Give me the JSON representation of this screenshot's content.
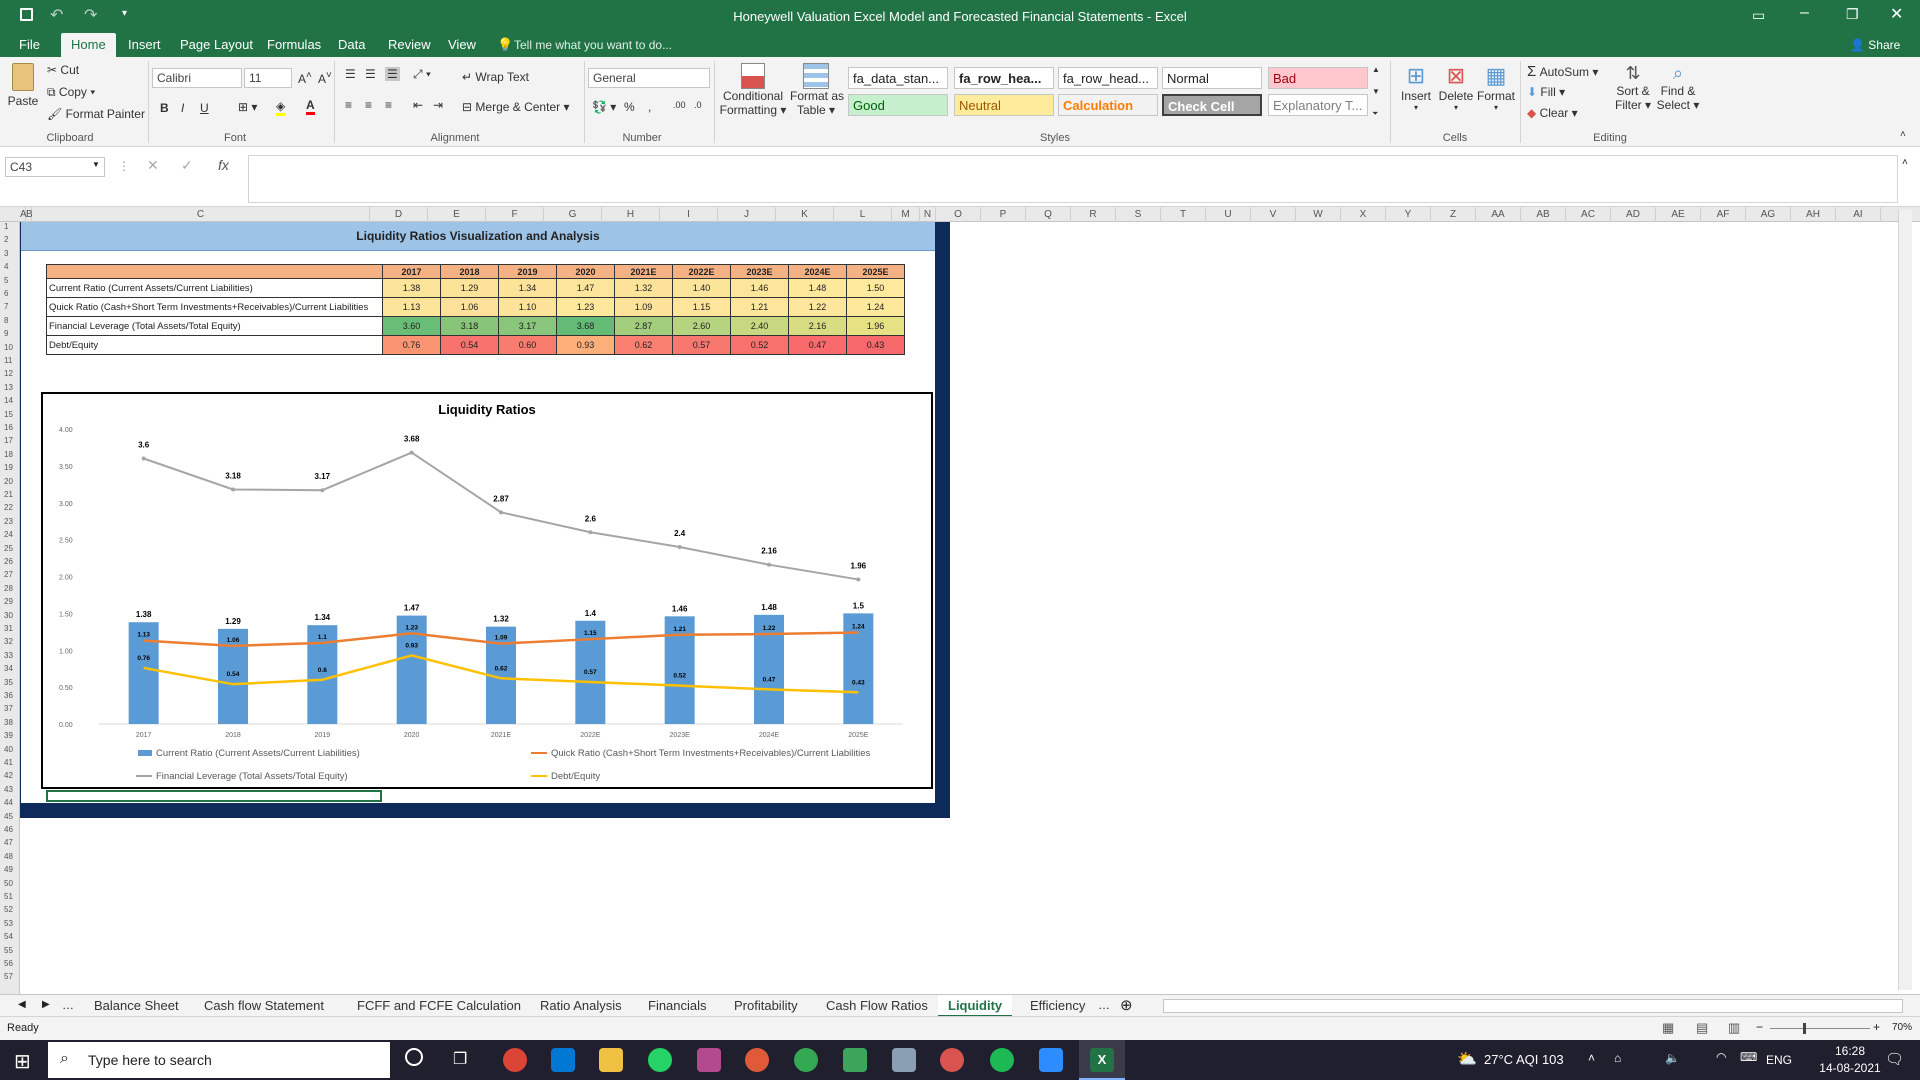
{
  "window": {
    "title": "Honeywell Valuation Excel Model and Forecasted Financial Statements - Excel"
  },
  "ribbon_tabs": [
    "File",
    "Home",
    "Insert",
    "Page Layout",
    "Formulas",
    "Data",
    "Review",
    "View"
  ],
  "tell_me": "Tell me what you want to do...",
  "share": "Share",
  "clipboard": {
    "paste": "Paste",
    "cut": "Cut",
    "copy": "Copy",
    "format_painter": "Format Painter",
    "label": "Clipboard"
  },
  "font": {
    "name": "Calibri",
    "size": "11",
    "label": "Font"
  },
  "alignment": {
    "wrap": "Wrap Text",
    "merge": "Merge & Center",
    "label": "Alignment"
  },
  "number": {
    "format": "General",
    "label": "Number"
  },
  "styles": {
    "conditional": "Conditional",
    "conditional2": "Formatting",
    "format_as": "Format as",
    "format_as2": "Table",
    "cells": [
      {
        "text": "fa_data_stan...",
        "bg": "#ffffff",
        "color": "#222222",
        "bold": false
      },
      {
        "text": "fa_row_hea...",
        "bg": "#ffffff",
        "color": "#222222",
        "bold": true
      },
      {
        "text": "fa_row_head...",
        "bg": "#ffffff",
        "color": "#222222",
        "bold": false
      },
      {
        "text": "Normal",
        "bg": "#ffffff",
        "color": "#222222",
        "bold": false
      },
      {
        "text": "Bad",
        "bg": "#ffc7ce",
        "color": "#9c0006",
        "bold": false
      },
      {
        "text": "Good",
        "bg": "#c6efce",
        "color": "#006100",
        "bold": false
      },
      {
        "text": "Neutral",
        "bg": "#ffeb9c",
        "color": "#9c5700",
        "bold": false
      },
      {
        "text": "Calculation",
        "bg": "#f2f2f2",
        "color": "#fa7d00",
        "bold": true
      },
      {
        "text": "Check Cell",
        "bg": "#a5a5a5",
        "color": "#ffffff",
        "bold": true
      },
      {
        "text": "Explanatory T...",
        "bg": "#ffffff",
        "color": "#7f7f7f",
        "bold": false
      }
    ],
    "label": "Styles"
  },
  "cells_grp": {
    "insert": "Insert",
    "delete": "Delete",
    "format": "Format",
    "label": "Cells"
  },
  "editing": {
    "autosum": "AutoSum",
    "fill": "Fill",
    "clear": "Clear",
    "sort": "Sort &",
    "sort2": "Filter",
    "find": "Find &",
    "find2": "Select",
    "label": "Editing"
  },
  "formula_bar": {
    "name_box": "C43",
    "fx": "fx",
    "value": ""
  },
  "columns": [
    "A",
    "B",
    "C",
    "D",
    "E",
    "F",
    "G",
    "H",
    "I",
    "J",
    "K",
    "L",
    "M",
    "N",
    "O",
    "P",
    "Q",
    "R",
    "S",
    "T",
    "U",
    "V",
    "W",
    "X",
    "Y",
    "Z",
    "AA",
    "AB",
    "AC",
    "AD",
    "AE",
    "AF",
    "AG",
    "AH",
    "AI"
  ],
  "sheet_title": "Liquidity Ratios Visualization and Analysis",
  "table": {
    "years": [
      "2017",
      "2018",
      "2019",
      "2020",
      "2021E",
      "2022E",
      "2023E",
      "2024E",
      "2025E"
    ],
    "rows": [
      {
        "label": "Current Ratio (Current Assets/Current Liabilities)",
        "values": [
          "1.38",
          "1.29",
          "1.34",
          "1.47",
          "1.32",
          "1.40",
          "1.46",
          "1.48",
          "1.50"
        ],
        "colors": [
          "#fce59b",
          "#fde29a",
          "#fde29a",
          "#fde69b",
          "#fde29a",
          "#fde49b",
          "#fde69b",
          "#fee89c",
          "#fee99c"
        ]
      },
      {
        "label": "Quick Ratio (Cash+Short Term Investments+Receivables)/Current Liabilities",
        "values": [
          "1.13",
          "1.06",
          "1.10",
          "1.23",
          "1.09",
          "1.15",
          "1.21",
          "1.22",
          "1.24"
        ],
        "colors": [
          "#fde49b",
          "#fde19a",
          "#fde39a",
          "#fee89c",
          "#fde29a",
          "#fee59b",
          "#fee79c",
          "#fee79c",
          "#fee89c"
        ]
      },
      {
        "label": "Financial Leverage (Total Assets/Total Equity)",
        "values": [
          "3.60",
          "3.18",
          "3.17",
          "3.68",
          "2.87",
          "2.60",
          "2.40",
          "2.16",
          "1.96"
        ],
        "colors": [
          "#6abd77",
          "#88c57b",
          "#89c67b",
          "#63bb76",
          "#a1cd7d",
          "#b6d37f",
          "#c6d880",
          "#d8dd82",
          "#e6e183"
        ]
      },
      {
        "label": "Debt/Equity",
        "values": [
          "0.76",
          "0.54",
          "0.60",
          "0.93",
          "0.62",
          "0.57",
          "0.52",
          "0.47",
          "0.43"
        ],
        "colors": [
          "#fa9473",
          "#f8736e",
          "#f97d6f",
          "#fcaf78",
          "#f97f70",
          "#f87870",
          "#f8716d",
          "#f86a6c",
          "#f8696b"
        ]
      }
    ]
  },
  "chart_data": {
    "type": "bar",
    "title": "Liquidity Ratios",
    "categories": [
      "2017",
      "2018",
      "2019",
      "2020",
      "2021E",
      "2022E",
      "2023E",
      "2024E",
      "2025E"
    ],
    "ylim": [
      0,
      4
    ],
    "yticks": [
      "0.00",
      "0.50",
      "1.00",
      "1.50",
      "2.00",
      "2.50",
      "3.00",
      "3.50",
      "4.00"
    ],
    "grid": false,
    "legend_position": "bottom",
    "series": [
      {
        "name": "Current Ratio (Current Assets/Current Liabilities)",
        "type": "bar",
        "color": "#5b9bd5",
        "values": [
          1.38,
          1.29,
          1.34,
          1.47,
          1.32,
          1.4,
          1.46,
          1.48,
          1.5
        ]
      },
      {
        "name": "Quick Ratio (Cash+Short Term Investments+Receivables)/Current Liabilities",
        "type": "line",
        "color": "#ed7d31",
        "values": [
          1.13,
          1.06,
          1.1,
          1.23,
          1.09,
          1.15,
          1.21,
          1.22,
          1.24
        ]
      },
      {
        "name": "Financial Leverage (Total Assets/Total Equity)",
        "type": "line",
        "color": "#a5a5a5",
        "values": [
          3.6,
          3.18,
          3.17,
          3.68,
          2.87,
          2.6,
          2.4,
          2.16,
          1.96
        ]
      },
      {
        "name": "Debt/Equity",
        "type": "line",
        "color": "#ffc000",
        "values": [
          0.76,
          0.54,
          0.6,
          0.93,
          0.62,
          0.57,
          0.52,
          0.47,
          0.43
        ]
      }
    ]
  },
  "sheet_tabs": [
    "Balance Sheet",
    "Cash flow Statement",
    "FCFF and FCFE Calculation",
    "Ratio Analysis",
    "Financials",
    "Profitability",
    "Cash Flow Ratios",
    "Liquidity",
    "Efficiency"
  ],
  "active_sheet": "Liquidity",
  "status": {
    "ready": "Ready",
    "zoom": "70%"
  },
  "taskbar": {
    "search": "Type here to search",
    "weather": "27°C  AQI 103",
    "lang": "ENG",
    "time": "16:28",
    "date": "14-08-2021"
  }
}
